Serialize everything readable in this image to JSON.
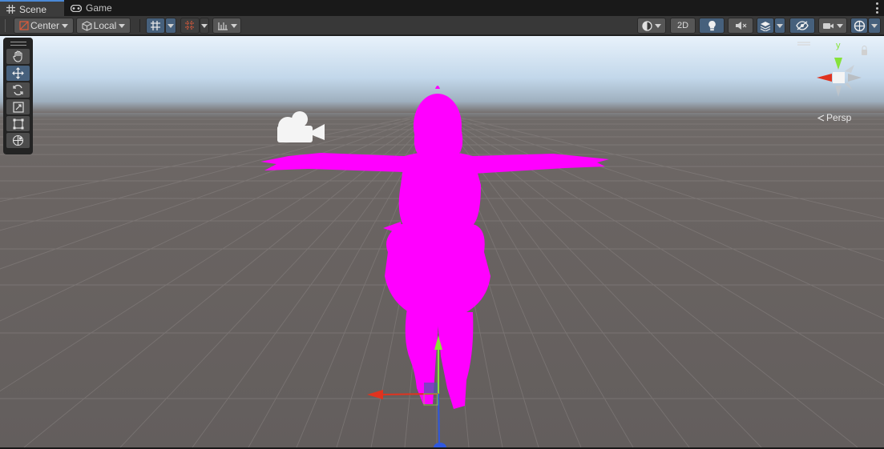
{
  "tabs": [
    {
      "label": "Scene",
      "icon": "grid-icon",
      "active": true
    },
    {
      "label": "Game",
      "icon": "gamepad-icon",
      "active": false
    }
  ],
  "toolbar": {
    "pivot_mode": "Center",
    "pivot_rotation": "Local",
    "view_2d": "2D"
  },
  "tools": [
    "hand-tool",
    "move-tool",
    "rotate-tool",
    "scale-tool",
    "rect-tool",
    "transform-tool"
  ],
  "gizmo": {
    "y_label": "y",
    "projection_label": "Persp"
  },
  "colors": {
    "model": "#ff00ff",
    "x_axis": "#e0331f",
    "y_axis": "#86e23a",
    "z_axis": "#2f58e0",
    "toolbar_active": "#46607c"
  }
}
